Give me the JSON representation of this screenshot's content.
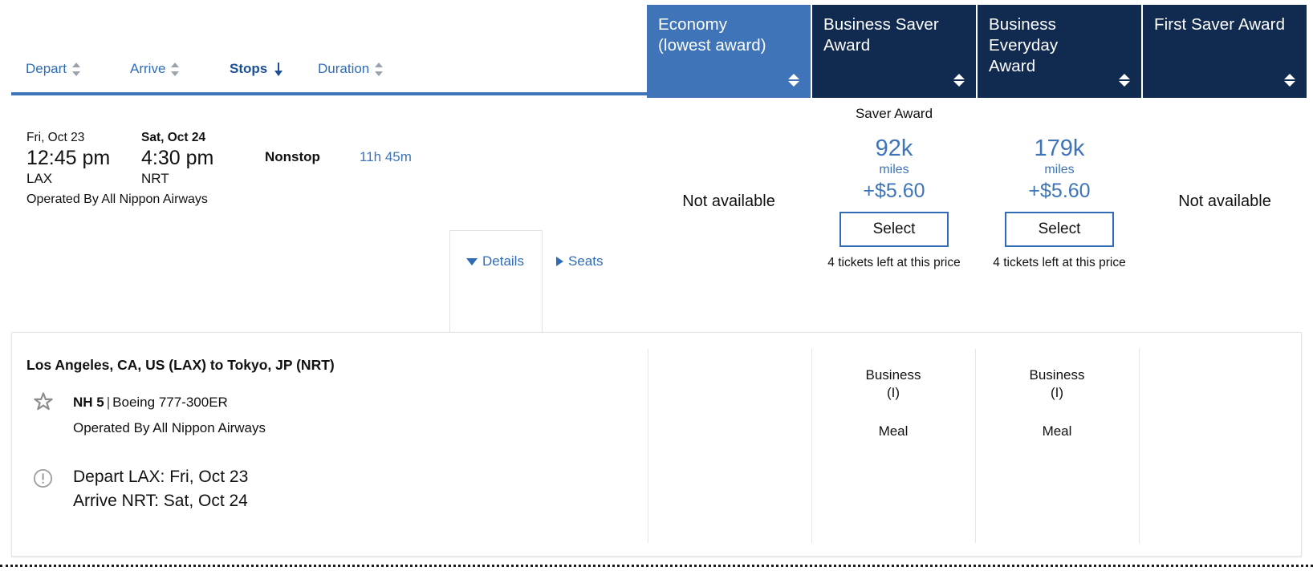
{
  "sort_bar": {
    "items": [
      {
        "label": "Depart",
        "icon": "sort-updown-icon",
        "active": false
      },
      {
        "label": "Arrive",
        "icon": "sort-updown-icon",
        "active": false
      },
      {
        "label": "Stops",
        "icon": "sort-arrow-down-icon",
        "active": true
      },
      {
        "label": "Duration",
        "icon": "sort-updown-icon",
        "active": false
      }
    ]
  },
  "fare_columns": [
    {
      "key": "economy",
      "title_line1": "Economy",
      "title_line2": "(lowest award)",
      "accent": true,
      "bg": "#3f74b8"
    },
    {
      "key": "business_saver",
      "title_line1": "Business Saver",
      "title_line2": "Award",
      "accent": false,
      "bg": "#112b50"
    },
    {
      "key": "business_everyday",
      "title_line1": "Business Everyday",
      "title_line2": "Award",
      "accent": false,
      "bg": "#112b50"
    },
    {
      "key": "first_saver",
      "title_line1": "First Saver Award",
      "title_line2": "",
      "accent": false,
      "bg": "#112b50"
    }
  ],
  "saver_award_caption": "Saver Award",
  "flight": {
    "depart_date": "Fri, Oct 23",
    "depart_time": "12:45 pm",
    "depart_airport": "LAX",
    "arrive_date": "Sat, Oct 24",
    "arrive_time": "4:30 pm",
    "arrive_airport": "NRT",
    "stops": "Nonstop",
    "duration": "11h 45m",
    "operated_by": "Operated By All Nippon Airways",
    "details_label": "Details",
    "seats_label": "Seats"
  },
  "fares": [
    {
      "column": "economy",
      "available": false,
      "unavailable_text": "Not available",
      "miles": "",
      "miles_unit": "",
      "cash": "",
      "select_label": "",
      "tickets_left": ""
    },
    {
      "column": "business_saver",
      "available": true,
      "unavailable_text": "",
      "miles": "92k",
      "miles_unit": "miles",
      "cash": "+$5.60",
      "select_label": "Select",
      "tickets_left": "4 tickets left at this price"
    },
    {
      "column": "business_everyday",
      "available": true,
      "unavailable_text": "",
      "miles": "179k",
      "miles_unit": "miles",
      "cash": "+$5.60",
      "select_label": "Select",
      "tickets_left": "4 tickets left at this price"
    },
    {
      "column": "first_saver",
      "available": false,
      "unavailable_text": "Not available",
      "miles": "",
      "miles_unit": "",
      "cash": "",
      "select_label": "",
      "tickets_left": ""
    }
  ],
  "details_panel": {
    "route": "Los Angeles, CA, US (LAX) to Tokyo, JP (NRT)",
    "alliance_icon": "star-alliance-icon",
    "flight_number": "NH 5",
    "separator": "|",
    "aircraft": "Boeing 777-300ER",
    "operated_by": "Operated By All Nippon Airways",
    "info_icon": "exclamation-circle-icon",
    "depart_line": "Depart LAX: Fri, Oct 23",
    "arrive_line": "Arrive NRT: Sat, Oct 24",
    "cabins": [
      {
        "column": "economy",
        "cabin": "",
        "fare_class": "",
        "meal": ""
      },
      {
        "column": "business_saver",
        "cabin": "Business",
        "fare_class": "(I)",
        "meal": "Meal"
      },
      {
        "column": "business_everyday",
        "cabin": "Business",
        "fare_class": "(I)",
        "meal": "Meal"
      },
      {
        "column": "first_saver",
        "cabin": "",
        "fare_class": "",
        "meal": ""
      }
    ]
  },
  "colors": {
    "accent_blue": "#3f74b8",
    "navy": "#112b50",
    "link_blue": "#2f6cb5",
    "text": "#111111"
  }
}
